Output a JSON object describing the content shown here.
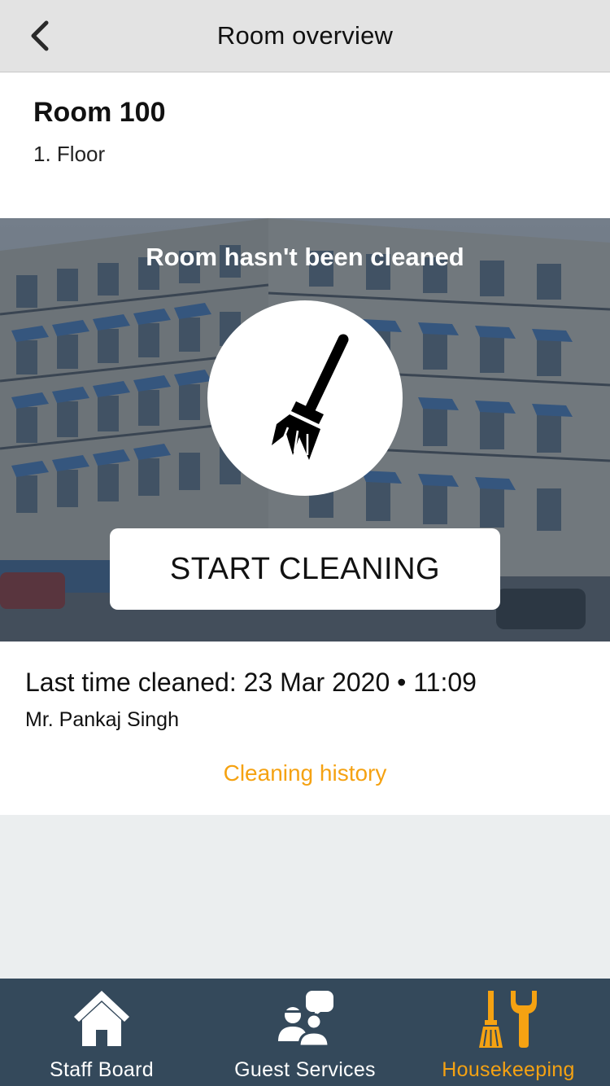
{
  "nav": {
    "title": "Room overview",
    "back_icon": "chevron-left-icon"
  },
  "room": {
    "name": "Room 100",
    "floor": "1. Floor"
  },
  "status": {
    "text": "Room hasn't been cleaned",
    "icon": "broom-icon",
    "button_label": "START CLEANING"
  },
  "last_cleaned": {
    "line": "Last time cleaned: 23 Mar 2020 • 11:09",
    "by": "Mr. Pankaj Singh",
    "history_link": "Cleaning history"
  },
  "tabs": [
    {
      "label": "Staff Board",
      "icon": "house-icon",
      "active": false
    },
    {
      "label": "Guest Services",
      "icon": "guests-chat-icon",
      "active": false
    },
    {
      "label": "Housekeeping",
      "icon": "broom-wrench-icon",
      "active": true
    }
  ],
  "colors": {
    "accent": "#f5a212",
    "tab_bar": "#34495b",
    "nav_bar": "#e3e3e3",
    "page_bg": "#ebeeef"
  }
}
